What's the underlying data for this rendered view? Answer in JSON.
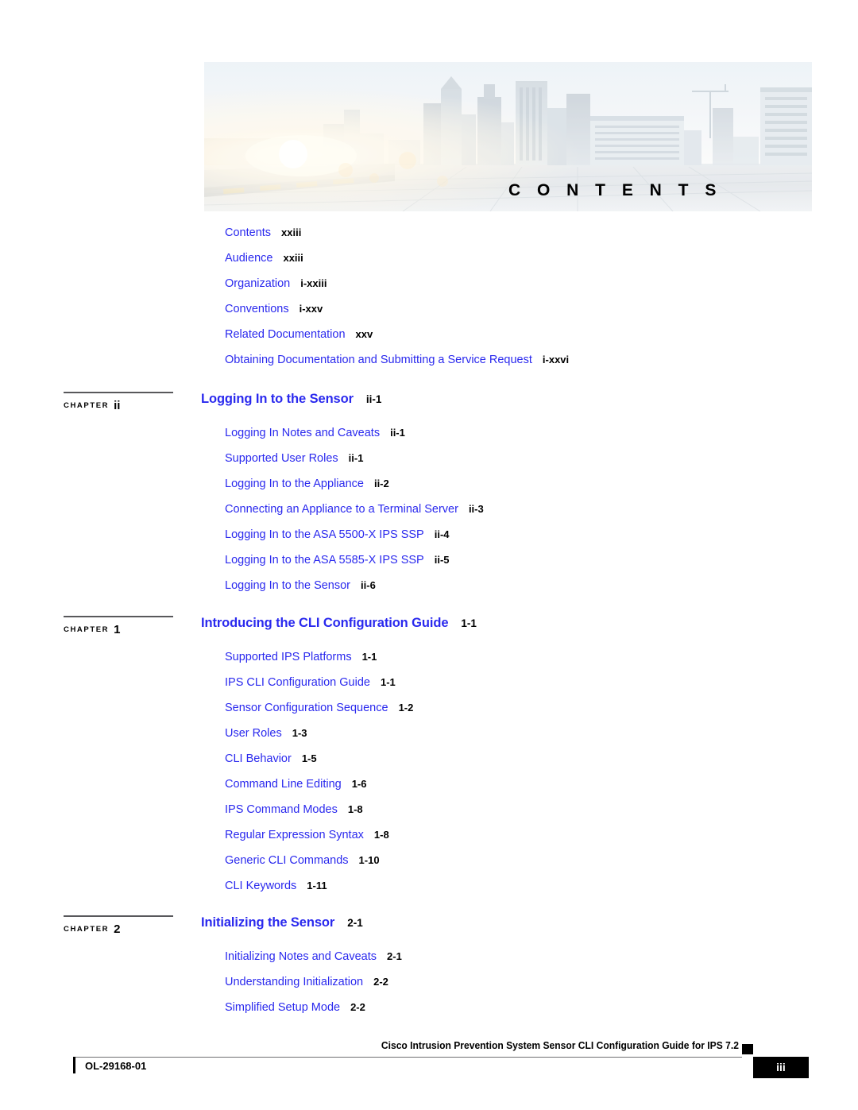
{
  "banner": {
    "title": "C O N T E N T S",
    "image_name": "city-skyline-sunrise-photo"
  },
  "front_matter": [
    {
      "label": "Contents",
      "page": "xxiii"
    },
    {
      "label": "Audience",
      "page": "xxiii"
    },
    {
      "label": "Organization",
      "page": "i-xxiii"
    },
    {
      "label": "Conventions",
      "page": "i-xxv"
    },
    {
      "label": "Related Documentation",
      "page": "xxv"
    },
    {
      "label": "Obtaining Documentation and Submitting a Service Request",
      "page": "i-xxvi"
    }
  ],
  "chapters": [
    {
      "marker_word": "CHAPTER",
      "number": "ii",
      "title": "Logging In to the Sensor",
      "page": "ii-1",
      "entries": [
        {
          "label": "Logging In Notes and Caveats",
          "page": "ii-1"
        },
        {
          "label": "Supported User Roles",
          "page": "ii-1"
        },
        {
          "label": "Logging In to the Appliance",
          "page": "ii-2"
        },
        {
          "label": "Connecting an Appliance to a Terminal Server",
          "page": "ii-3"
        },
        {
          "label": "Logging In to the ASA 5500-X IPS SSP",
          "page": "ii-4"
        },
        {
          "label": "Logging In to the ASA 5585-X IPS SSP",
          "page": "ii-5"
        },
        {
          "label": "Logging In to the Sensor",
          "page": "ii-6"
        }
      ]
    },
    {
      "marker_word": "CHAPTER",
      "number": "1",
      "title": "Introducing the CLI Configuration Guide",
      "page": "1-1",
      "entries": [
        {
          "label": "Supported IPS Platforms",
          "page": "1-1"
        },
        {
          "label": "IPS CLI Configuration Guide",
          "page": "1-1"
        },
        {
          "label": "Sensor Configuration Sequence",
          "page": "1-2"
        },
        {
          "label": "User Roles",
          "page": "1-3"
        },
        {
          "label": "CLI Behavior",
          "page": "1-5"
        },
        {
          "label": "Command Line Editing",
          "page": "1-6"
        },
        {
          "label": "IPS Command Modes",
          "page": "1-8"
        },
        {
          "label": "Regular Expression Syntax",
          "page": "1-8"
        },
        {
          "label": "Generic CLI Commands",
          "page": "1-10"
        },
        {
          "label": "CLI Keywords",
          "page": "1-11"
        }
      ]
    },
    {
      "marker_word": "CHAPTER",
      "number": "2",
      "title": "Initializing the Sensor",
      "page": "2-1",
      "entries": [
        {
          "label": "Initializing Notes and Caveats",
          "page": "2-1"
        },
        {
          "label": "Understanding Initialization",
          "page": "2-2"
        },
        {
          "label": "Simplified Setup Mode",
          "page": "2-2"
        }
      ]
    }
  ],
  "footer": {
    "doc_id": "OL-29168-01",
    "title": "Cisco Intrusion Prevention System Sensor CLI Configuration Guide for IPS 7.2",
    "page_number": "iii"
  },
  "colors": {
    "link_blue": "#2a29ee",
    "text_black": "#000000",
    "rule_gray": "#58585b"
  }
}
